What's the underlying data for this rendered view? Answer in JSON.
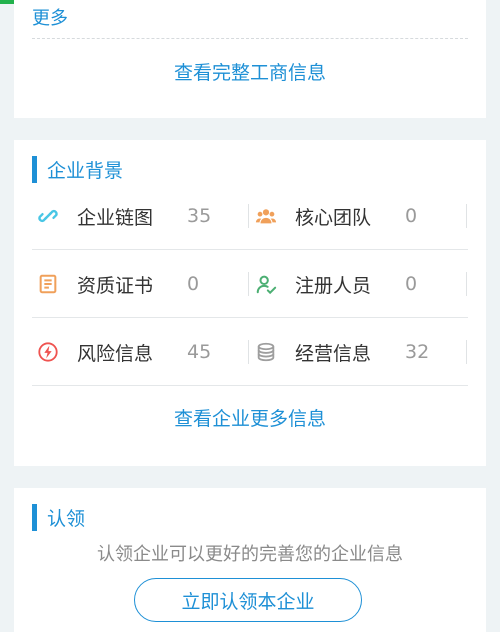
{
  "top_card": {
    "more_label": "更多",
    "view_full_business_info": "查看完整工商信息"
  },
  "background_section": {
    "title": "企业背景",
    "items": [
      {
        "label": "企业链图",
        "count": "35",
        "icon": "link-icon",
        "color": "#49c6e5"
      },
      {
        "label": "核心团队",
        "count": "0",
        "icon": "team-icon",
        "color": "#f0a05a"
      },
      {
        "label": "资质证书",
        "count": "0",
        "icon": "certificate-icon",
        "color": "#f0a05a"
      },
      {
        "label": "注册人员",
        "count": "0",
        "icon": "registered-person-icon",
        "color": "#4caf73"
      },
      {
        "label": "风险信息",
        "count": "45",
        "icon": "lightning-icon",
        "color": "#ef5350"
      },
      {
        "label": "经营信息",
        "count": "32",
        "icon": "coins-icon",
        "color": "#9e9e9e"
      }
    ],
    "view_more": "查看企业更多信息"
  },
  "claim_section": {
    "title": "认领",
    "description": "认领企业可以更好的完善您的企业信息",
    "button_label": "立即认领本企业"
  },
  "colors": {
    "accent": "#1e90d6",
    "background": "#eef3f5"
  }
}
